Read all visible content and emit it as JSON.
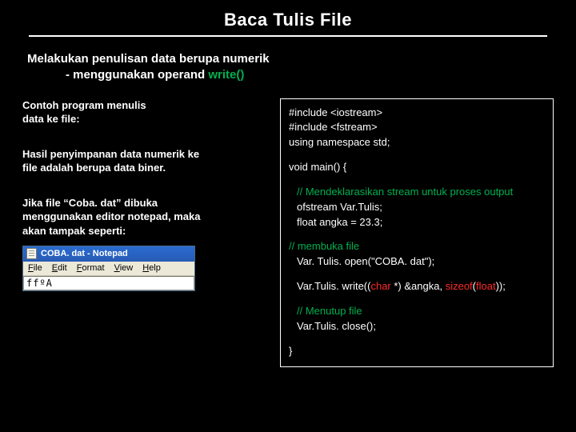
{
  "title": "Baca Tulis File",
  "subtitle": {
    "line1": "Melakukan penulisan data berupa numerik",
    "line2_prefix": "- menggunakan operand ",
    "line2_emph": "write()"
  },
  "left": {
    "p1a": "Contoh program menulis",
    "p1b": "data ke file:",
    "p2a": "Hasil penyimpanan data numerik ke",
    "p2b": "file adalah berupa data biner.",
    "p3a": "Jika file “Coba. dat” dibuka",
    "p3b": "menggunakan editor notepad, maka",
    "p3c": "akan tampak seperti:"
  },
  "notepad": {
    "title": "COBA. dat - Notepad",
    "menu": {
      "file": "File",
      "edit": "Edit",
      "format": "Format",
      "view": "View",
      "help": "Help"
    },
    "body": "ffºA"
  },
  "code": {
    "l1": "#include <iostream>",
    "l2": "#include <fstream>",
    "l3": "using namespace std;",
    "l4": "void main() {",
    "c1": "// Mendeklarasikan stream untuk proses output",
    "l5": "ofstream Var.Tulis;",
    "l6": "float angka = 23.3;",
    "c2": "// membuka file",
    "l7": "Var. Tulis. open(\"COBA. dat\");",
    "l8_a": "Var.Tulis. write((",
    "l8_b": "char",
    "l8_c": " *) &angka, ",
    "l8_d": "sizeof",
    "l8_e": "(",
    "l8_f": "float",
    "l8_g": "));",
    "c3": "// Menutup file",
    "l9": "Var.Tulis. close();",
    "l10": "}"
  }
}
